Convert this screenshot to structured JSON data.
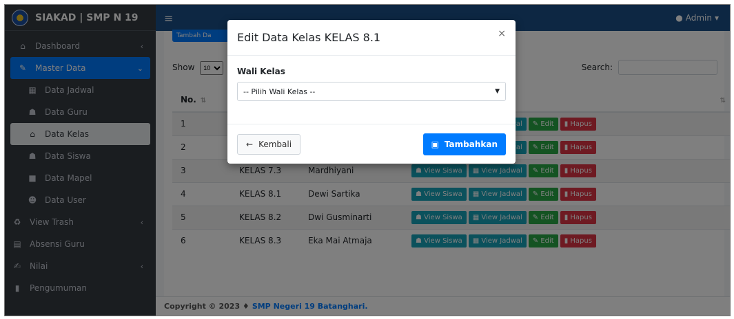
{
  "brand": {
    "title": "SIAKAD | SMP N 19"
  },
  "sidebar": {
    "items": [
      {
        "icon": "home-icon",
        "label": "Dashboard",
        "caret": "‹"
      },
      {
        "icon": "edit-icon",
        "label": "Master Data",
        "caret": "⌄",
        "active": true
      },
      {
        "icon": "calendar-icon",
        "label": "Data Jadwal",
        "sub": true
      },
      {
        "icon": "users-icon",
        "label": "Data Guru",
        "sub": true
      },
      {
        "icon": "home-icon",
        "label": "Data Kelas",
        "sub": true,
        "sub_active": true
      },
      {
        "icon": "users-icon",
        "label": "Data Siswa",
        "sub": true
      },
      {
        "icon": "book-icon",
        "label": "Data Mapel",
        "sub": true
      },
      {
        "icon": "user-plus-icon",
        "label": "Data User",
        "sub": true
      },
      {
        "icon": "recycle-icon",
        "label": "View Trash",
        "caret": "‹"
      },
      {
        "icon": "calendar-check-icon",
        "label": "Absensi Guru"
      },
      {
        "icon": "signature-icon",
        "label": "Nilai",
        "caret": "‹"
      },
      {
        "icon": "file-icon",
        "label": "Pengumuman"
      }
    ]
  },
  "topbar": {
    "user": "Admin"
  },
  "content": {
    "add_button": "Tambah Da",
    "show_label": "Show",
    "show_value": "10",
    "search_label": "Search:",
    "table": {
      "headers": [
        "No.",
        "",
        "",
        ""
      ],
      "rows": [
        {
          "no": "1",
          "kelas": "",
          "wali": ""
        },
        {
          "no": "2",
          "kelas": "",
          "wali": ""
        },
        {
          "no": "3",
          "kelas": "KELAS 7.3",
          "wali": "Mardhiyani"
        },
        {
          "no": "4",
          "kelas": "KELAS 8.1",
          "wali": "Dewi Sartika"
        },
        {
          "no": "5",
          "kelas": "KELAS 8.2",
          "wali": "Dwi Gusminarti"
        },
        {
          "no": "6",
          "kelas": "KELAS 8.3",
          "wali": "Eka Mai Atmaja"
        }
      ],
      "actions": {
        "view_siswa": "View Siswa",
        "view_jadwal": "View Jadwal",
        "edit": "Edit",
        "hapus": "Hapus"
      }
    }
  },
  "footer": {
    "text": "Copyright © 2023 ♦",
    "link": "SMP Negeri 19 Batanghari."
  },
  "modal": {
    "title": "Edit Data Kelas KELAS 8.1",
    "close": "×",
    "field_label": "Wali Kelas",
    "select_value": "-- Pilih Wali Kelas --",
    "back_label": "Kembali",
    "submit_label": "Tambahkan"
  }
}
